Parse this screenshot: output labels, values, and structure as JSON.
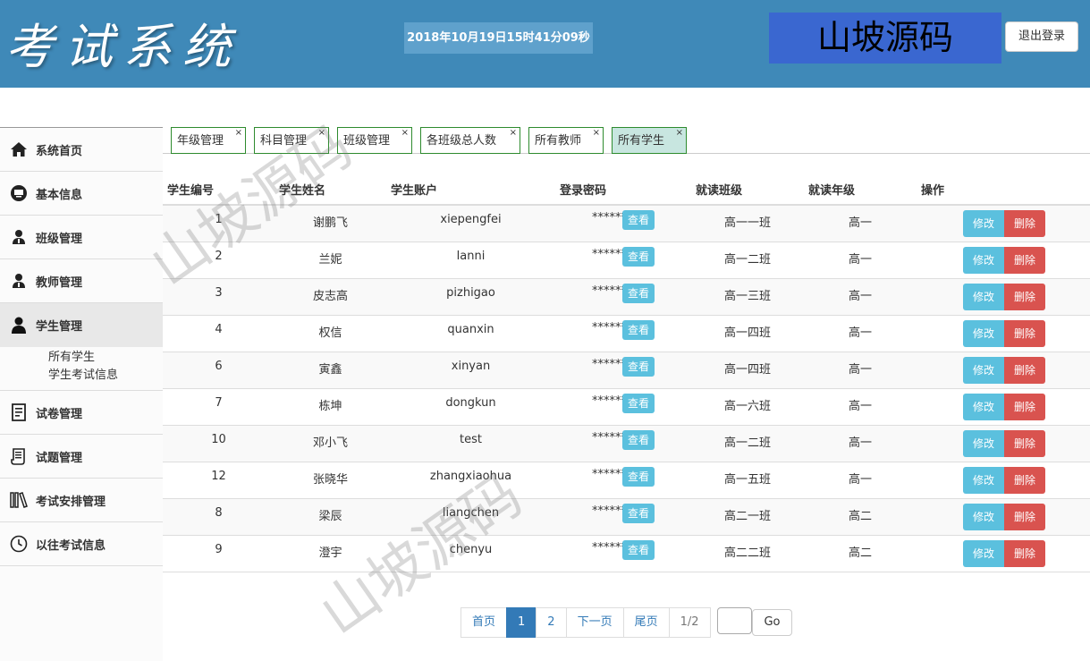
{
  "header": {
    "logo": "考试系统",
    "datetime": "2018年10月19日15时41分09秒",
    "brand": "山坡源码",
    "logout_label": "退出登录"
  },
  "sidebar": {
    "items": [
      {
        "label": "系统首页",
        "icon": "home-icon"
      },
      {
        "label": "基本信息",
        "icon": "monitor-icon"
      },
      {
        "label": "班级管理",
        "icon": "user-icon"
      },
      {
        "label": "教师管理",
        "icon": "user-icon"
      },
      {
        "label": "学生管理",
        "icon": "user-icon"
      },
      {
        "label": "试卷管理",
        "icon": "document-icon"
      },
      {
        "label": "试题管理",
        "icon": "scroll-icon"
      },
      {
        "label": "考试安排管理",
        "icon": "books-icon"
      },
      {
        "label": "以往考试信息",
        "icon": "clock-icon"
      }
    ],
    "submenu": [
      "所有学生",
      "学生考试信息"
    ]
  },
  "tabs": [
    "年级管理",
    "科目管理",
    "班级管理",
    "各班级总人数",
    "所有教师",
    "所有学生"
  ],
  "table": {
    "headers": [
      "学生编号",
      "学生姓名",
      "学生账户",
      "登录密码",
      "就读班级",
      "就读年级",
      "操作"
    ],
    "view_label": "查看",
    "edit_label": "修改",
    "delete_label": "删除",
    "rows": [
      {
        "id": "1",
        "name": "谢鹏飞",
        "account": "xiepengfei",
        "password": "******",
        "class": "高一一班",
        "grade": "高一"
      },
      {
        "id": "2",
        "name": "兰妮",
        "account": "lanni",
        "password": "******",
        "class": "高一二班",
        "grade": "高一"
      },
      {
        "id": "3",
        "name": "皮志高",
        "account": "pizhigao",
        "password": "******",
        "class": "高一三班",
        "grade": "高一"
      },
      {
        "id": "4",
        "name": "权信",
        "account": "quanxin",
        "password": "******",
        "class": "高一四班",
        "grade": "高一"
      },
      {
        "id": "6",
        "name": "寅鑫",
        "account": "xinyan",
        "password": "******",
        "class": "高一四班",
        "grade": "高一"
      },
      {
        "id": "7",
        "name": "栋坤",
        "account": "dongkun",
        "password": "******",
        "class": "高一六班",
        "grade": "高一"
      },
      {
        "id": "10",
        "name": "邓小飞",
        "account": "test",
        "password": "******",
        "class": "高一二班",
        "grade": "高一"
      },
      {
        "id": "12",
        "name": "张晓华",
        "account": "zhangxiaohua",
        "password": "******",
        "class": "高一五班",
        "grade": "高一"
      },
      {
        "id": "8",
        "name": "梁辰",
        "account": "liangchen",
        "password": "******",
        "class": "高二一班",
        "grade": "高二"
      },
      {
        "id": "9",
        "name": "澄宇",
        "account": "chenyu",
        "password": "******",
        "class": "高二二班",
        "grade": "高二"
      }
    ]
  },
  "pagination": {
    "first": "首页",
    "pages": [
      "1",
      "2"
    ],
    "current": "1",
    "next": "下一页",
    "last": "尾页",
    "info": "1/2",
    "go": "Go"
  },
  "watermark": "山坡源码"
}
